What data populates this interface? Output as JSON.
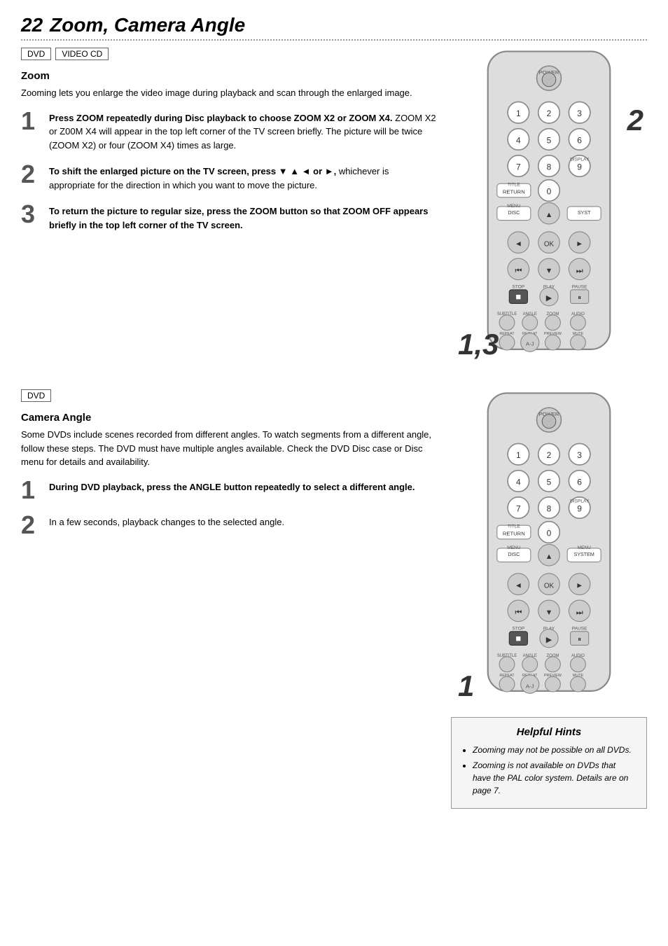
{
  "header": {
    "page_num": "22",
    "title": "Zoom, Camera Angle"
  },
  "zoom_section": {
    "badges": [
      "DVD",
      "VIDEO CD"
    ],
    "title": "Zoom",
    "description": "Zooming lets you enlarge the video image during playback and scan through the enlarged image.",
    "steps": [
      {
        "num": "1",
        "text": "Press ZOOM repeatedly during Disc playback to choose ZOOM X2 or ZOOM X4. ZOOM X2 or Z00M X4 will appear in the top left corner of the TV screen briefly. The picture will be twice (ZOOM X2) or four (ZOOM X4) times as large."
      },
      {
        "num": "2",
        "text": "To shift the enlarged picture on the TV screen, press ▼ ▲ ◄ or ►, whichever is appropriate for the direction in which you want to move the picture."
      },
      {
        "num": "3",
        "text": "To return the picture to regular size, press the ZOOM button so that ZOOM OFF appears briefly in the top left corner of the TV screen."
      }
    ],
    "step_indicator": "1,3",
    "step_indicator2": "2"
  },
  "camera_section": {
    "badges": [
      "DVD"
    ],
    "title": "Camera Angle",
    "description": "Some DVDs include scenes recorded from different angles. To watch segments from a different angle, follow these steps. The DVD must have multiple angles available. Check the DVD Disc case or Disc menu for details and availability.",
    "steps": [
      {
        "num": "1",
        "text": "During DVD playback, press the ANGLE button repeatedly to select a different angle."
      },
      {
        "num": "2",
        "text": "In a few seconds, playback changes to the selected angle."
      }
    ],
    "step_indicator": "1"
  },
  "helpful_hints": {
    "title": "Helpful Hints",
    "items": [
      "Zooming may not be possible on all DVDs.",
      "Zooming is not available on DVDs that have the PAL color system. Details are on page 7."
    ]
  }
}
